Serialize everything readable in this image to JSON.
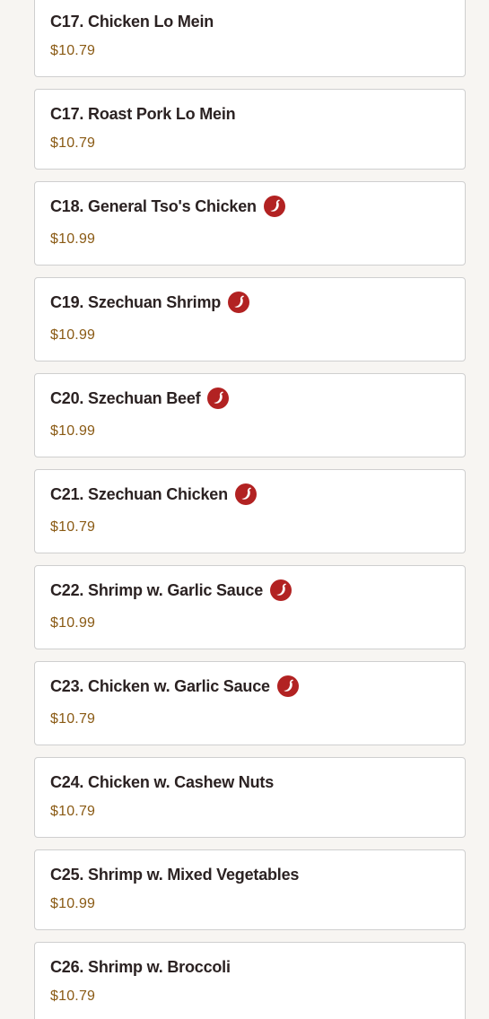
{
  "colors": {
    "background": "#f7f5f2",
    "card_background": "#ffffff",
    "card_border": "#cfcfcf",
    "title_text": "#2b2222",
    "price_text": "#8a5a14",
    "spicy_badge": "#b22222"
  },
  "menu": {
    "items": [
      {
        "name": "C17. Chicken Lo Mein",
        "price": "$10.79",
        "spicy": false
      },
      {
        "name": "C17. Roast Pork Lo Mein",
        "price": "$10.79",
        "spicy": false
      },
      {
        "name": "C18. General Tso's Chicken",
        "price": "$10.99",
        "spicy": true,
        "icon": "spicy-pepper-icon"
      },
      {
        "name": "C19. Szechuan Shrimp",
        "price": "$10.99",
        "spicy": true,
        "icon": "spicy-pepper-icon"
      },
      {
        "name": "C20. Szechuan Beef",
        "price": "$10.99",
        "spicy": true,
        "icon": "spicy-pepper-icon"
      },
      {
        "name": "C21. Szechuan Chicken",
        "price": "$10.79",
        "spicy": true,
        "icon": "spicy-pepper-icon"
      },
      {
        "name": "C22. Shrimp w. Garlic Sauce",
        "price": "$10.99",
        "spicy": true,
        "icon": "spicy-pepper-icon"
      },
      {
        "name": "C23. Chicken w. Garlic Sauce",
        "price": "$10.79",
        "spicy": true,
        "icon": "spicy-pepper-icon"
      },
      {
        "name": "C24. Chicken w. Cashew Nuts",
        "price": "$10.79",
        "spicy": false
      },
      {
        "name": "C25. Shrimp w. Mixed Vegetables",
        "price": "$10.99",
        "spicy": false
      },
      {
        "name": "C26. Shrimp w. Broccoli",
        "price": "$10.79",
        "spicy": false
      }
    ]
  }
}
